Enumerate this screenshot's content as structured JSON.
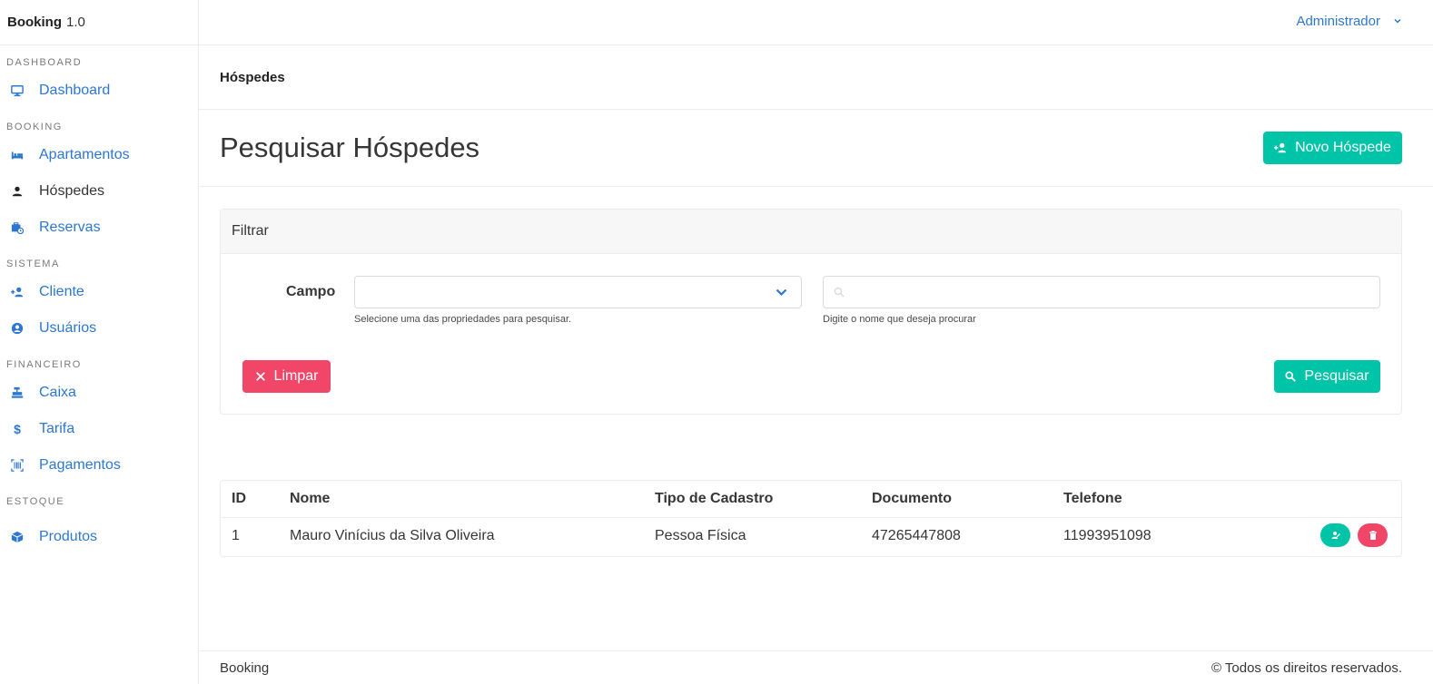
{
  "app": {
    "name": "Booking",
    "version": "1.0"
  },
  "topbar": {
    "user": "Administrador"
  },
  "sidebar": {
    "sections": [
      {
        "label": "DASHBOARD",
        "items": [
          {
            "label": "Dashboard",
            "icon": "monitor-icon"
          }
        ]
      },
      {
        "label": "BOOKING",
        "items": [
          {
            "label": "Apartamentos",
            "icon": "bed-icon"
          },
          {
            "label": "Hóspedes",
            "icon": "user-icon",
            "active": true
          },
          {
            "label": "Reservas",
            "icon": "briefcase-clock-icon"
          }
        ]
      },
      {
        "label": "SISTEMA",
        "items": [
          {
            "label": "Cliente",
            "icon": "user-plus-icon"
          },
          {
            "label": "Usuários",
            "icon": "user-circle-icon"
          }
        ]
      },
      {
        "label": "FINANCEIRO",
        "items": [
          {
            "label": "Caixa",
            "icon": "cash-register-icon"
          },
          {
            "label": "Tarifa",
            "icon": "dollar-icon"
          },
          {
            "label": "Pagamentos",
            "icon": "barcode-icon"
          }
        ]
      },
      {
        "label": "ESTOQUE",
        "items": [
          {
            "label": "Produtos",
            "icon": "box-icon"
          }
        ]
      }
    ]
  },
  "breadcrumb": "Hóspedes",
  "page": {
    "title": "Pesquisar Hóspedes",
    "new_button": "Novo Hóspede"
  },
  "filter": {
    "title": "Filtrar",
    "field_label": "Campo",
    "select_value": "",
    "select_help": "Selecione uma das propriedades para pesquisar.",
    "search_value": "",
    "search_help": "Digite o nome que deseja procurar",
    "clear_button": "Limpar",
    "search_button": "Pesquisar"
  },
  "table": {
    "columns": [
      "ID",
      "Nome",
      "Tipo de Cadastro",
      "Documento",
      "Telefone"
    ],
    "rows": [
      [
        "1",
        "Mauro Vinícius da Silva Oliveira",
        "Pessoa Física",
        "47265447808",
        "11993951098"
      ]
    ]
  },
  "footer": {
    "left": "Booking",
    "right": "© Todos os direitos reservados."
  },
  "colors": {
    "link": "#2e77d0",
    "primary": "#00c4a7",
    "danger": "#f14668"
  }
}
